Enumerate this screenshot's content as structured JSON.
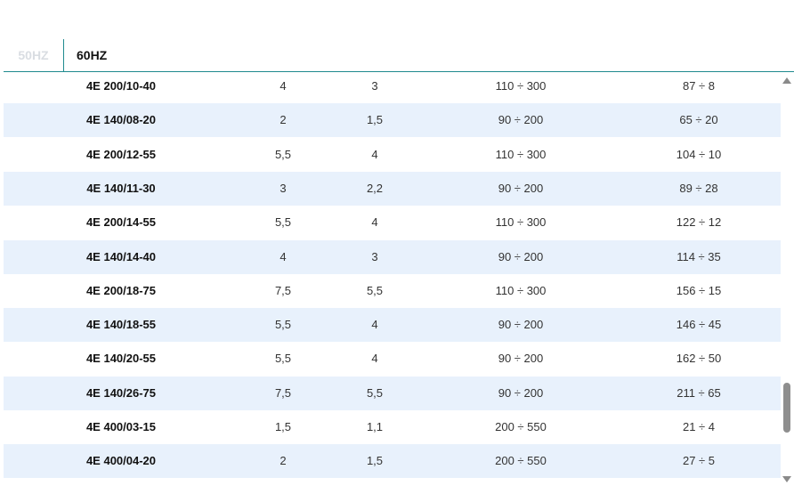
{
  "tabs": [
    {
      "label": "50HZ",
      "active": false
    },
    {
      "label": "60HZ",
      "active": true
    }
  ],
  "table": {
    "rows": [
      [
        "4E 200/10-40",
        "4",
        "3",
        "110 ÷ 300",
        "87 ÷ 8"
      ],
      [
        "4E 140/08-20",
        "2",
        "1,5",
        "90 ÷ 200",
        "65 ÷ 20"
      ],
      [
        "4E 200/12-55",
        "5,5",
        "4",
        "110 ÷ 300",
        "104 ÷ 10"
      ],
      [
        "4E 140/11-30",
        "3",
        "2,2",
        "90 ÷ 200",
        "89 ÷ 28"
      ],
      [
        "4E 200/14-55",
        "5,5",
        "4",
        "110 ÷ 300",
        "122 ÷ 12"
      ],
      [
        "4E 140/14-40",
        "4",
        "3",
        "90 ÷ 200",
        "114 ÷ 35"
      ],
      [
        "4E 200/18-75",
        "7,5",
        "5,5",
        "110 ÷ 300",
        "156 ÷ 15"
      ],
      [
        "4E 140/18-55",
        "5,5",
        "4",
        "90 ÷ 200",
        "146 ÷ 45"
      ],
      [
        "4E 140/20-55",
        "5,5",
        "4",
        "90 ÷ 200",
        "162 ÷ 50"
      ],
      [
        "4E 140/26-75",
        "7,5",
        "5,5",
        "90 ÷ 200",
        "211 ÷ 65"
      ],
      [
        "4E 400/03-15",
        "1,5",
        "1,1",
        "200 ÷ 550",
        "21 ÷ 4"
      ],
      [
        "4E 400/04-20",
        "2",
        "1,5",
        "200 ÷ 550",
        "27 ÷ 5"
      ]
    ]
  },
  "colors": {
    "accent": "#1f8a8f",
    "row_alt": "#e8f1fc",
    "tab_inactive": "#d9dde2"
  }
}
